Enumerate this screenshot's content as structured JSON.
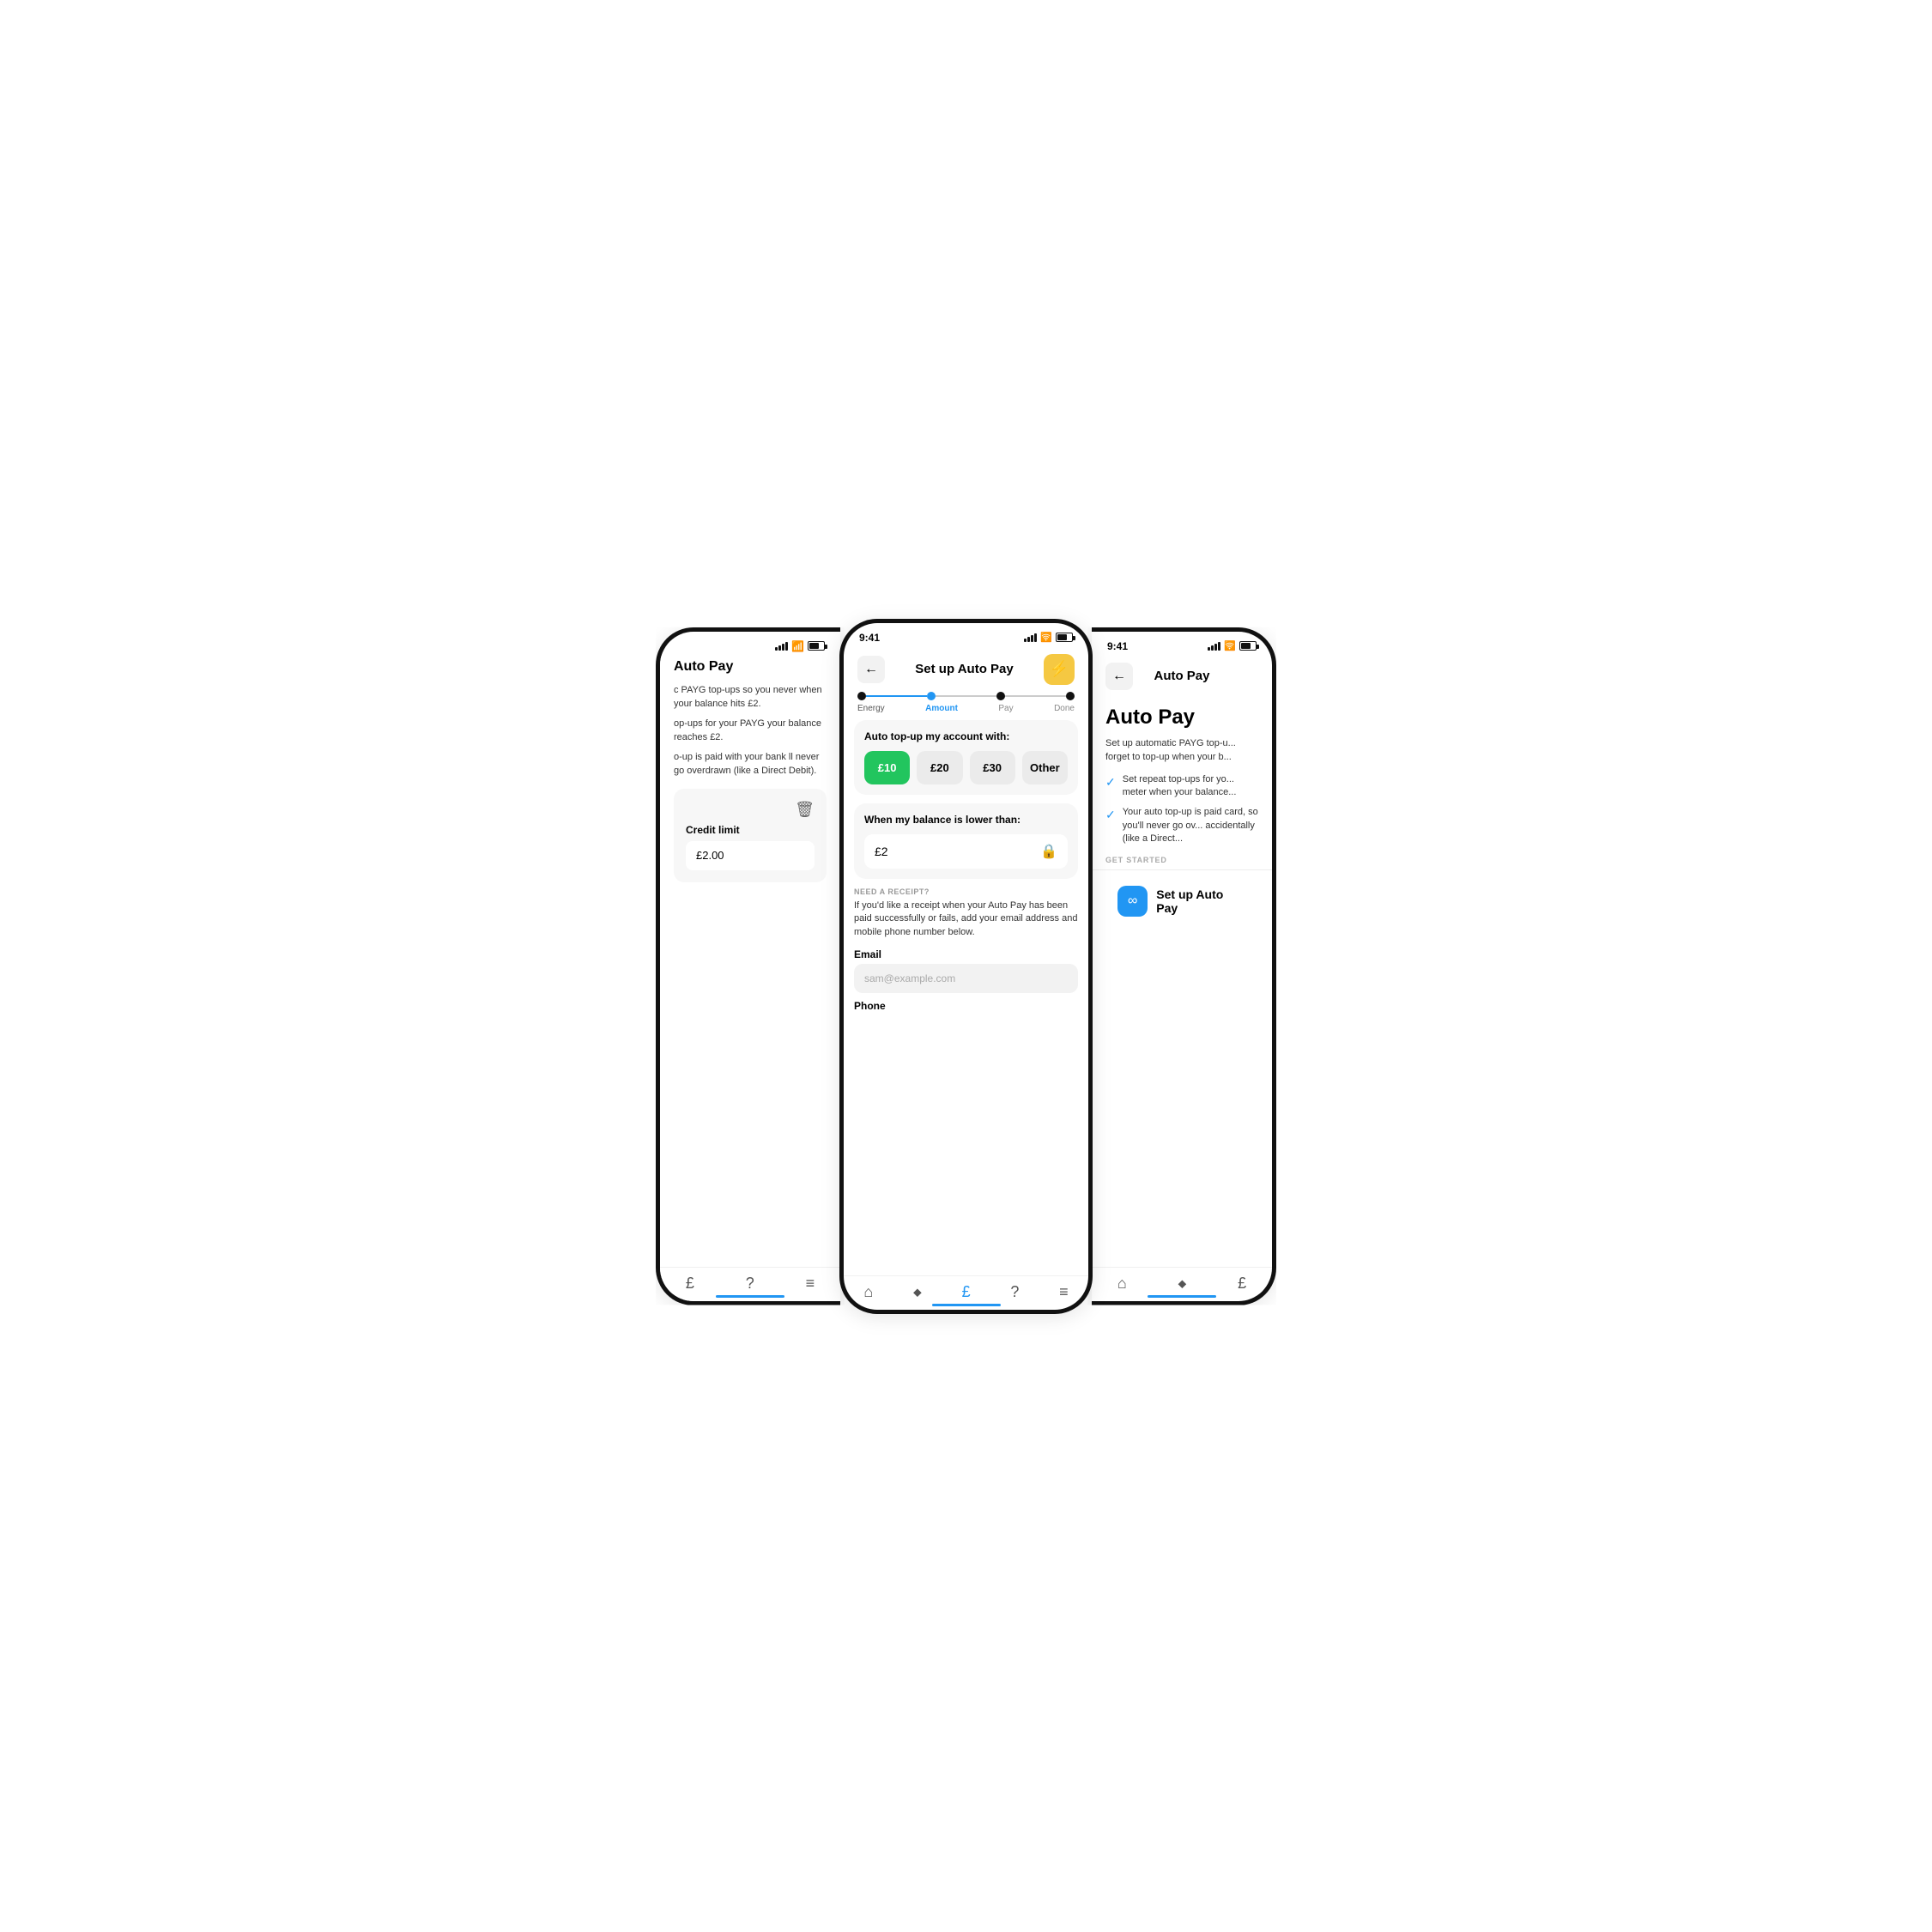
{
  "left_phone": {
    "status": {
      "time": "",
      "has_time": false
    },
    "header": {
      "title": "Auto Pay"
    },
    "description_1": "c PAYG top-ups so you never when your balance hits £2.",
    "description_2": "op-ups for your PAYG your balance reaches £2.",
    "description_3": "o-up is paid with your bank ll never go overdrawn (like a Direct Debit).",
    "credit_section": {
      "delete_icon": "🗑",
      "label": "Credit limit",
      "amount": "£2.00"
    },
    "bottom_nav": {
      "icons": [
        "£",
        "?",
        "≡"
      ]
    }
  },
  "center_phone": {
    "status": {
      "time": "9:41"
    },
    "header": {
      "back_label": "←",
      "title": "Set up Auto Pay",
      "icon": "⚡"
    },
    "progress": {
      "steps": [
        {
          "label": "Energy",
          "state": "completed"
        },
        {
          "label": "Amount",
          "state": "active"
        },
        {
          "label": "Pay",
          "state": "default"
        },
        {
          "label": "Done",
          "state": "default"
        }
      ]
    },
    "topup_section": {
      "label": "Auto top-up my account with:",
      "amounts": [
        {
          "value": "£10",
          "selected": true
        },
        {
          "value": "£20",
          "selected": false
        },
        {
          "value": "£30",
          "selected": false
        },
        {
          "value": "Other",
          "selected": false
        }
      ]
    },
    "balance_section": {
      "label": "When my balance is lower than:",
      "value": "£2",
      "icon": "🔒"
    },
    "receipt_section": {
      "heading": "NEED A RECEIPT?",
      "description": "If you'd like a receipt when your Auto Pay has been paid successfully or fails, add your email address and mobile phone number below.",
      "email_label": "Email",
      "email_placeholder": "sam@example.com",
      "phone_label": "Phone"
    },
    "bottom_nav": {
      "icons": [
        "🏠",
        "⟐",
        "£",
        "?",
        "≡"
      ]
    }
  },
  "right_phone": {
    "status": {
      "time": "9:41"
    },
    "header": {
      "back_label": "←",
      "title": "Auto Pay"
    },
    "title": "Auto Pay",
    "description": "Set up automatic PAYG top-u... forget to top-up when your b...",
    "checks": [
      "Set repeat top-ups for yo... meter when your balance...",
      "Your auto top-up is paid card, so you'll never go ov... accidentally (like a Direct..."
    ],
    "get_started_label": "GET STARTED",
    "setup_button": {
      "icon": "∞",
      "label": "Set up Auto Pay"
    },
    "bottom_nav": {
      "icons": [
        "🏠",
        "⟐",
        "£"
      ]
    }
  },
  "colors": {
    "active_blue": "#2196F3",
    "selected_green": "#22c55e",
    "yellow": "#f5c842",
    "background": "#ffffff",
    "card_bg": "#f7f7f7",
    "text_primary": "#111111",
    "text_secondary": "#666666",
    "border": "#e0e0e0"
  }
}
